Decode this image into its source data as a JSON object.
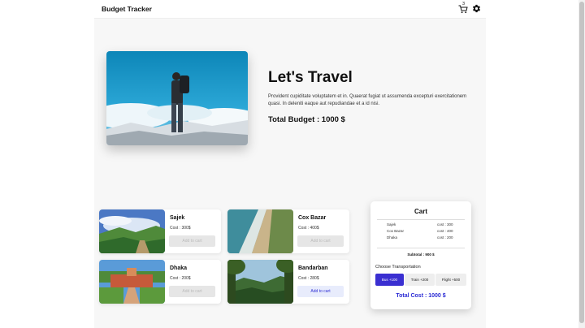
{
  "app": {
    "title": "Budget Tracker",
    "cart_count": "3"
  },
  "hero": {
    "title": "Let's Travel",
    "description": "Provident cupiditate voluptatem et in. Quaerat fugiat ut assumenda excepturi exercitationem quasi. In deleniti eaque aut repudiandae et a id nisi.",
    "budget": "Total Budget : 1000 $"
  },
  "places": [
    {
      "name": "Sajek",
      "cost": "Cost : 300$",
      "button": "Add to cart",
      "state": "disabled"
    },
    {
      "name": "Cox Bazar",
      "cost": "Cost : 400$",
      "button": "Add to cart",
      "state": "disabled"
    },
    {
      "name": "Dhaka",
      "cost": "Cost : 200$",
      "button": "Add to cart",
      "state": "disabled"
    },
    {
      "name": "Bandarban",
      "cost": "Cost : 280$",
      "button": "Add to cart",
      "state": "active"
    }
  ],
  "cart": {
    "title": "Cart",
    "items": [
      {
        "name": "Sajek",
        "cost": "cost : 300"
      },
      {
        "name": "Cox Bazar",
        "cost": "cost : 400"
      },
      {
        "name": "Dhaka",
        "cost": "cost : 200"
      }
    ],
    "subtotal": "Subtotal : 900 $",
    "transport_label": "Choose Transportation",
    "transport": [
      {
        "label": "Bus +100",
        "selected": true
      },
      {
        "label": "Train +200",
        "selected": false
      },
      {
        "label": "Flight +500",
        "selected": false
      }
    ],
    "total": "Total Cost : 1000 $"
  },
  "colors": {
    "accent": "#3a2fd1",
    "total_text": "#2b2bd4",
    "disabled_btn": "#e6e6e6"
  },
  "icons": [
    "cart-icon",
    "gear-icon"
  ]
}
